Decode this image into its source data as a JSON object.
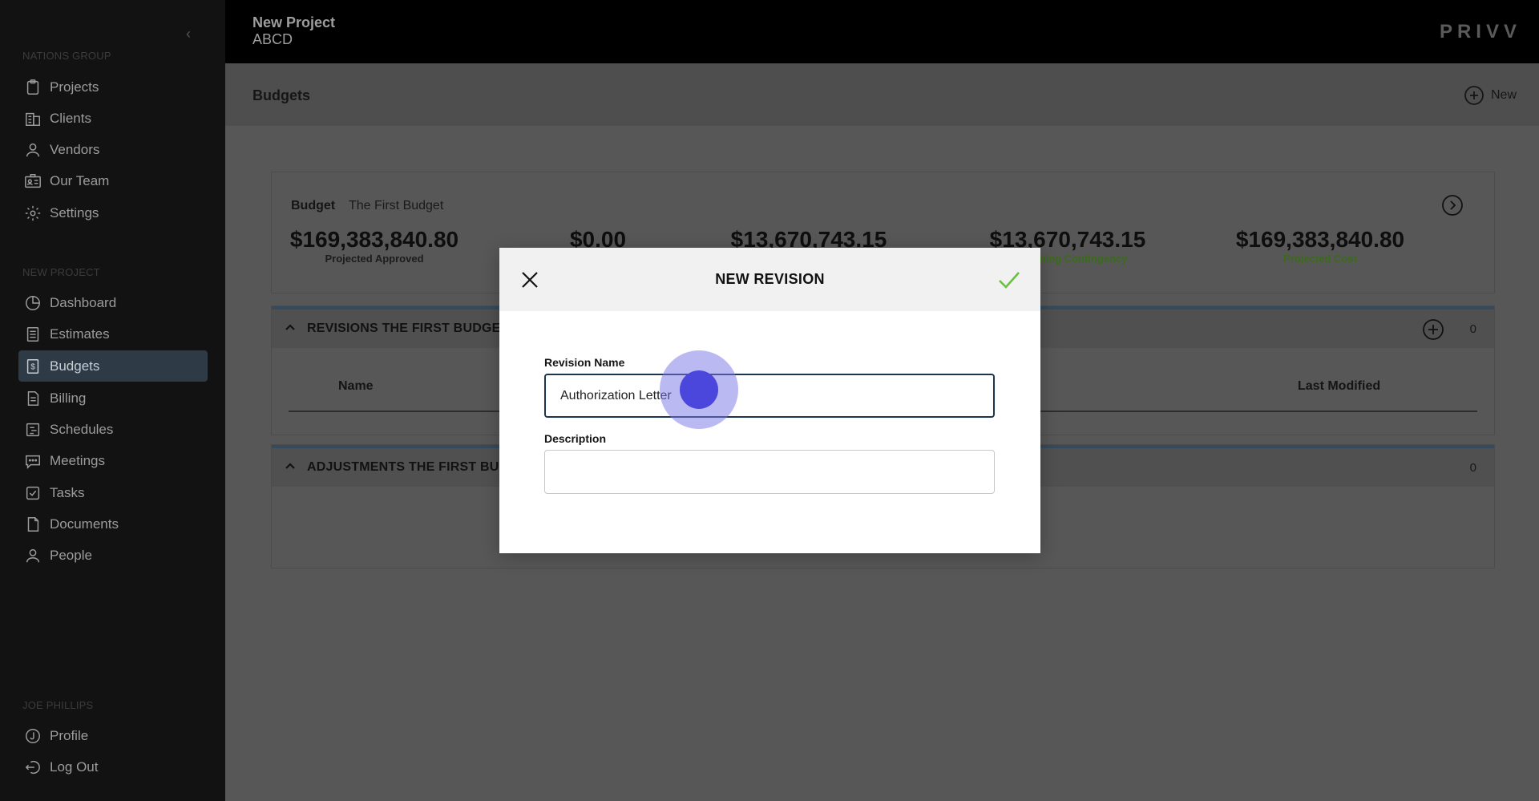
{
  "sidebar": {
    "org_label": "NATIONS GROUP",
    "org_items": [
      {
        "label": "Projects",
        "icon": "clipboard-icon"
      },
      {
        "label": "Clients",
        "icon": "building-icon"
      },
      {
        "label": "Vendors",
        "icon": "vendor-icon"
      },
      {
        "label": "Our Team",
        "icon": "id-card-icon"
      },
      {
        "label": "Settings",
        "icon": "gear-icon"
      }
    ],
    "project_label": "NEW PROJECT",
    "project_items": [
      {
        "label": "Dashboard",
        "icon": "pie-chart-icon"
      },
      {
        "label": "Estimates",
        "icon": "calculator-icon"
      },
      {
        "label": "Budgets",
        "icon": "dollar-document-icon",
        "active": true
      },
      {
        "label": "Billing",
        "icon": "invoice-icon"
      },
      {
        "label": "Schedules",
        "icon": "schedule-icon"
      },
      {
        "label": "Meetings",
        "icon": "chat-icon"
      },
      {
        "label": "Tasks",
        "icon": "checkbox-icon"
      },
      {
        "label": "Documents",
        "icon": "document-icon"
      },
      {
        "label": "People",
        "icon": "person-icon"
      }
    ],
    "user_label": "JOE PHILLIPS",
    "user_items": [
      {
        "label": "Profile",
        "icon": "profile-icon"
      },
      {
        "label": "Log Out",
        "icon": "logout-icon"
      }
    ]
  },
  "topbar": {
    "project_title": "New Project",
    "project_code": "ABCD",
    "brand": "PRIVV"
  },
  "header": {
    "title": "Budgets",
    "new_label": "New"
  },
  "budget": {
    "label": "Budget",
    "name": "The First Budget",
    "stats": [
      {
        "amount": "$169,383,840.80",
        "caption": "Projected Approved",
        "green": false
      },
      {
        "amount": "$0.00",
        "caption": "",
        "green": false
      },
      {
        "amount": "$13,670,743.15",
        "caption": "",
        "green": false
      },
      {
        "amount": "$13,670,743.15",
        "caption": "Remaining Contingency",
        "green": true
      },
      {
        "amount": "$169,383,840.80",
        "caption": "Projected Cost",
        "green": true
      }
    ]
  },
  "revisions": {
    "title": "REVISIONS THE FIRST BUDGET",
    "count": "0",
    "col_name": "Name",
    "col_modified": "Last Modified"
  },
  "adjustments": {
    "title": "ADJUSTMENTS THE FIRST BUDGET",
    "count": "0"
  },
  "modal": {
    "title": "NEW REVISION",
    "revision_name_label": "Revision Name",
    "revision_name_value": "Authorization Letter",
    "description_label": "Description",
    "description_value": ""
  }
}
